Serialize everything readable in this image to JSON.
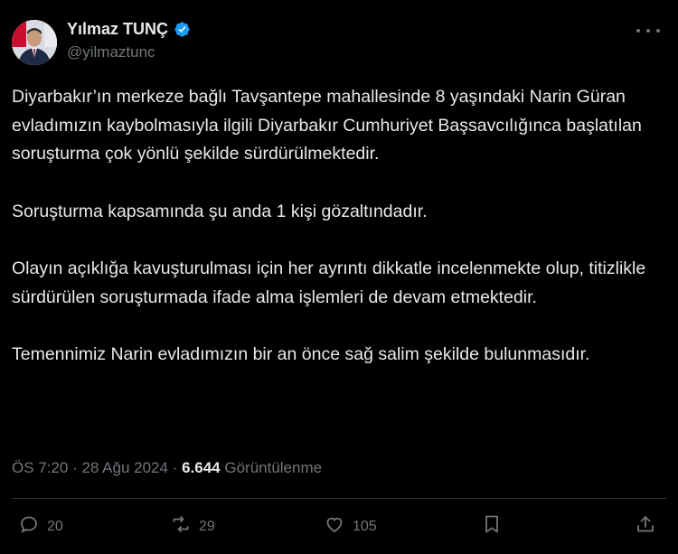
{
  "author": {
    "display_name": "Yılmaz TUNÇ",
    "handle": "@yilmaztunc",
    "verified": true
  },
  "tweet": {
    "paragraphs": [
      "Diyarbakır’ın merkeze bağlı Tavşantepe mahallesinde 8 yaşındaki Narin Güran evladımızın kaybolmasıyla ilgili Diyarbakır Cumhuriyet Başsavcılığınca başlatılan soruşturma çok yönlü şekilde sürdürülmektedir.",
      "Soruşturma kapsamında şu anda 1 kişi gözaltındadır.",
      "Olayın açıklığa kavuşturulması için her ayrıntı dikkatle incelenmekte olup, titizlikle sürdürülen soruşturmada ifade alma işlemleri de devam etmektedir.",
      "Temennimiz Narin evladımızın bir an önce sağ salim şekilde bulunmasıdır."
    ]
  },
  "meta": {
    "time": "ÖS 7:20",
    "separator": " · ",
    "date": "28 Ağu 2024",
    "views": "6.644",
    "views_label": "Görüntülenme"
  },
  "actions": {
    "replies": "20",
    "reposts": "29",
    "likes": "105"
  },
  "colors": {
    "background": "#000000",
    "text": "#e7e9ea",
    "secondary": "#71767b",
    "verified": "#1d9bf0"
  }
}
